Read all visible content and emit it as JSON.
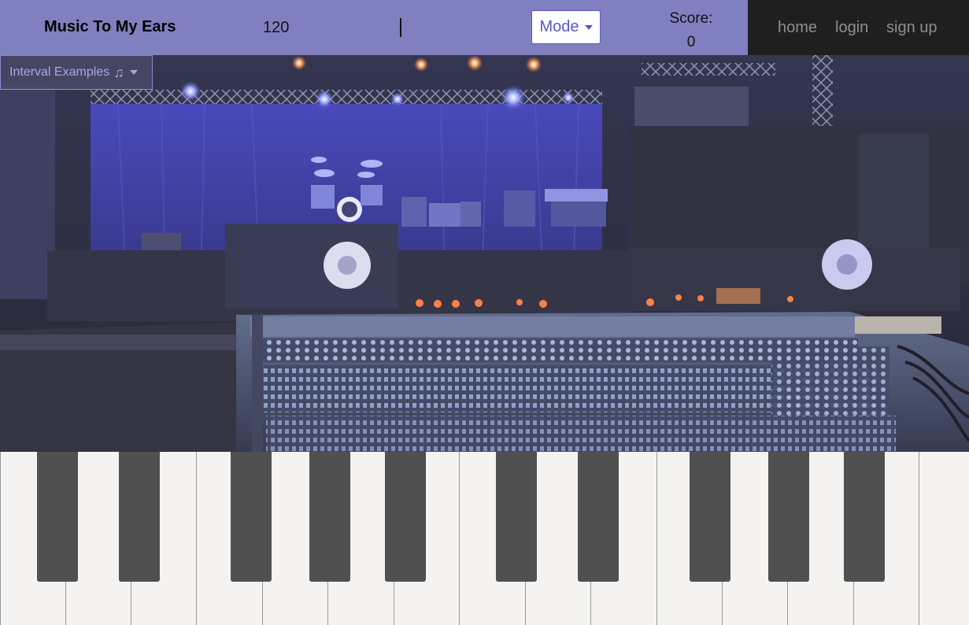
{
  "header": {
    "brand": "Music To My Ears",
    "tempo": "120",
    "mode_label": "Mode",
    "score_label": "Score:",
    "score_value": "0"
  },
  "nav": {
    "home": "home",
    "login": "login",
    "signup": "sign up"
  },
  "toolbar": {
    "interval_examples_label": "Interval Examples",
    "interval_icon": "music-note-icon"
  },
  "hero_image": "concert-stage-mixing-console",
  "piano": {
    "white_keys": 15,
    "black_keys": 10
  },
  "colors": {
    "header_bg": "#8080c0",
    "nav_bg": "#1f1f1f",
    "accent": "#5b56c9",
    "white_key": "#f4f3f1",
    "black_key": "#505050"
  }
}
